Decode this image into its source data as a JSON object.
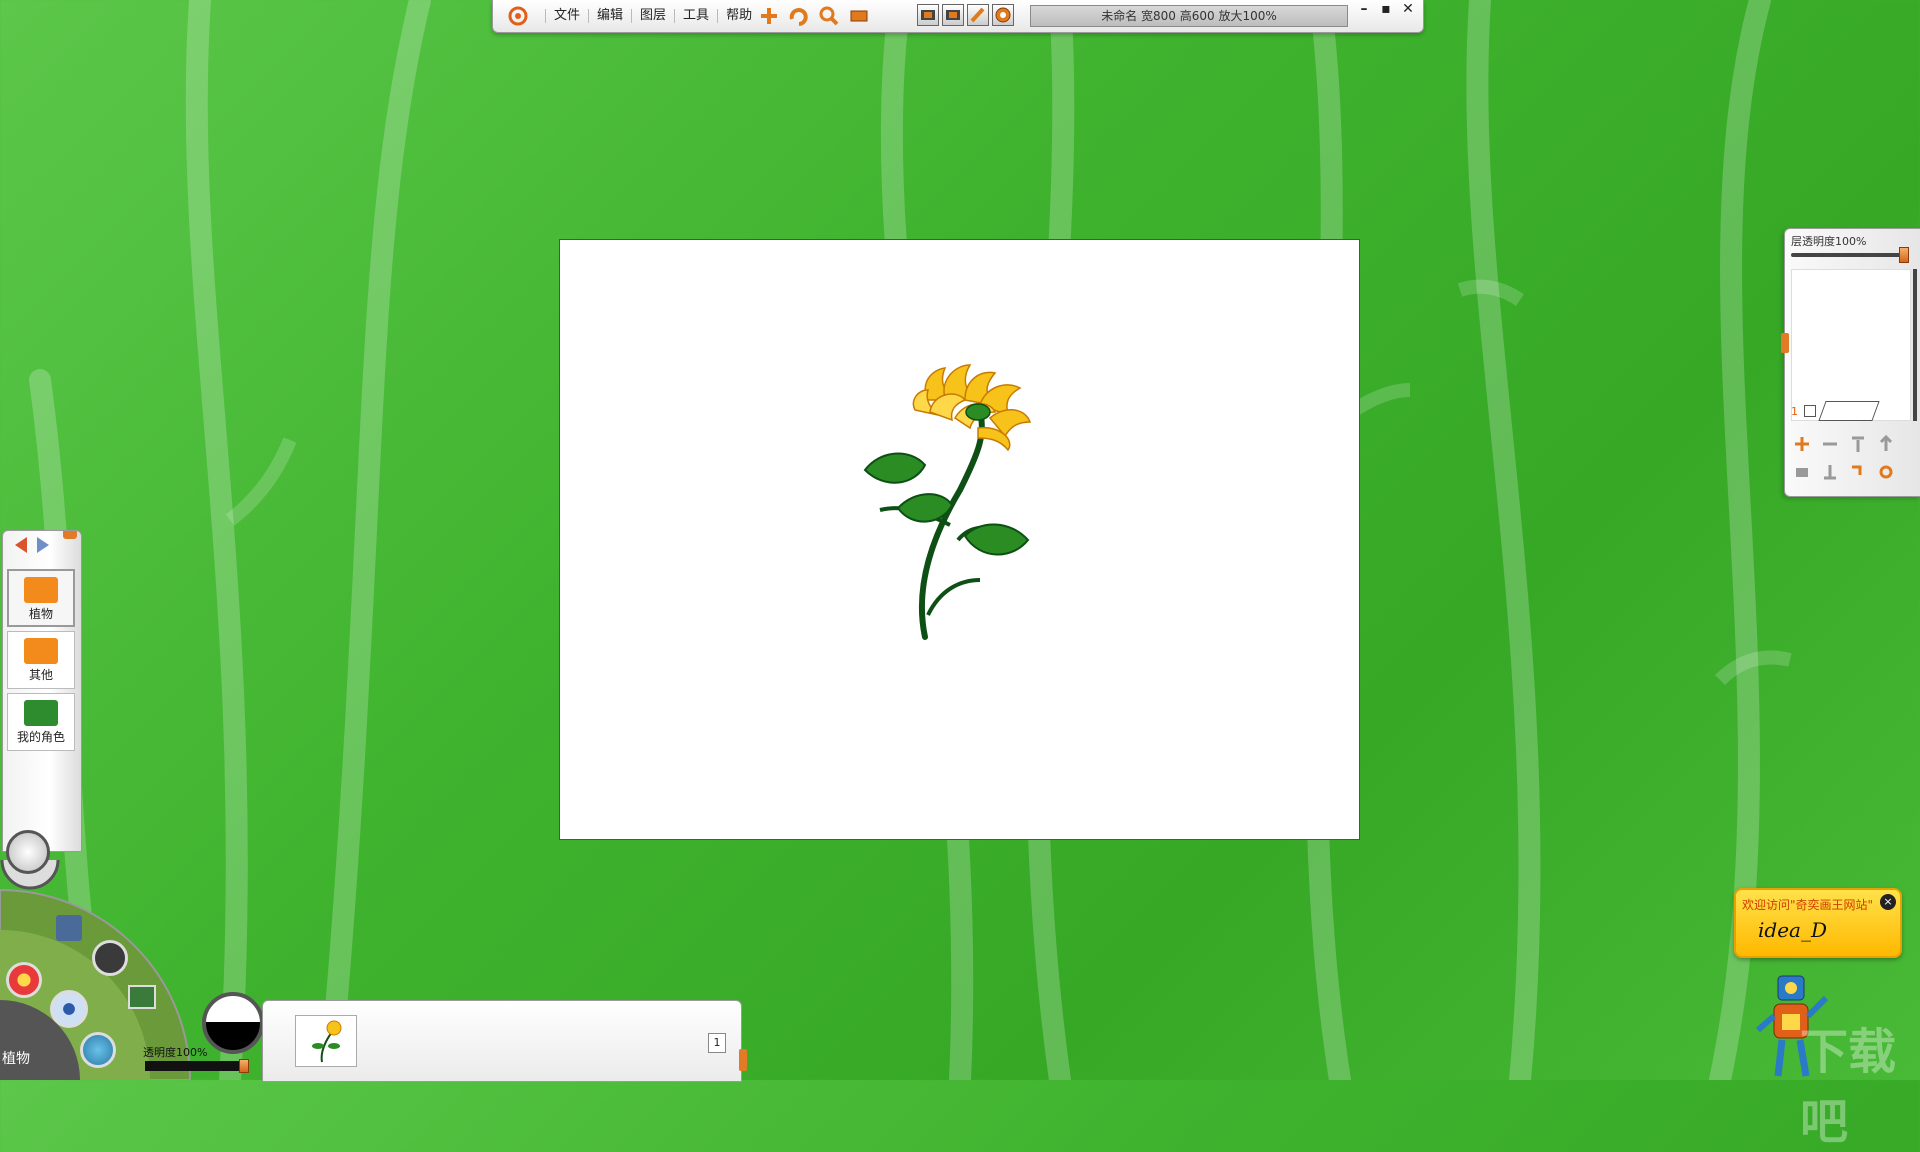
{
  "toolbar": {
    "menu": [
      {
        "label": "文件"
      },
      {
        "label": "编辑"
      },
      {
        "label": "图层"
      },
      {
        "label": "工具"
      },
      {
        "label": "帮助"
      }
    ],
    "icons": [
      "add-icon",
      "rotate-icon",
      "zoom-icon",
      "frame-icon"
    ],
    "icons2": [
      "film-icon",
      "film-edit-icon",
      "pen-icon",
      "record-icon"
    ],
    "status": "未命名 宽800 高600 放大100%"
  },
  "layer_panel": {
    "title": "层透明度100%",
    "opacity": 1.0,
    "layers": [
      {
        "number": "1"
      }
    ]
  },
  "library": {
    "items": [
      {
        "label": "植物",
        "color": "#f28a1c"
      },
      {
        "label": "其他",
        "color": "#f28a1c"
      },
      {
        "label": "我的角色",
        "color": "#2e8b2e"
      }
    ]
  },
  "bottom": {
    "category": "植物",
    "opacity_label": "透明度100%",
    "opacity": 1.0,
    "page_number": "1"
  },
  "ad": {
    "text": "欢迎访问\"奇奕画王网站\"",
    "logo": "idea_D",
    "close": "×"
  },
  "watermark": "下载吧",
  "colors": {
    "background": "#44b531",
    "accent": "#e27b28",
    "flower_yellow": "#f7c21a",
    "leaf_green": "#2a8c22"
  }
}
